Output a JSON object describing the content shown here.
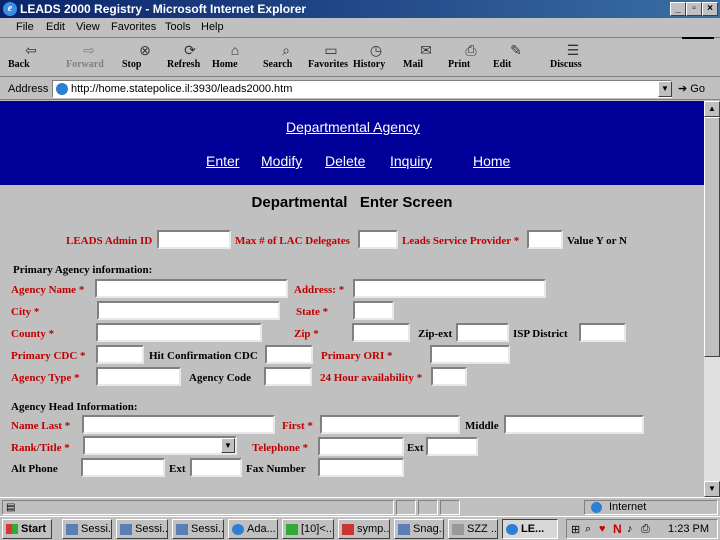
{
  "window": {
    "title": "LEADS 2000 Registry - Microsoft Internet Explorer"
  },
  "menubar": {
    "items": [
      "File",
      "Edit",
      "View",
      "Favorites",
      "Tools",
      "Help"
    ]
  },
  "toolbar": {
    "buttons": [
      "Back",
      "Forward",
      "Stop",
      "Refresh",
      "Home",
      "Search",
      "Favorites",
      "History",
      "Mail",
      "Print",
      "Edit",
      "Discuss"
    ]
  },
  "address": {
    "label": "Address",
    "url": "http://home.statepolice.il:3930/leads2000.htm",
    "go": "Go"
  },
  "banner": {
    "title": "Departmental Agency",
    "nav": [
      "Enter",
      "Modify",
      "Delete",
      "Inquiry",
      "Home"
    ]
  },
  "form": {
    "title": "Departmental   Enter Screen",
    "row1": {
      "admin_id": "LEADS Admin ID",
      "max_lac": "Max # of LAC Delegates",
      "service_provider": "Leads Service Provider *",
      "value_hint": "Value Y or N"
    },
    "primary_heading": "Primary Agency information:",
    "agency_name": "Agency Name *",
    "address": "Address: *",
    "city": "City  *",
    "state": "State *",
    "county": "County *",
    "zip": "Zip *",
    "zip_ext": "Zip-ext",
    "isp_district": "ISP District",
    "primary_cdc": "Primary CDC *",
    "hit_cdc": "Hit Confirmation CDC",
    "primary_ori": "Primary ORI *",
    "agency_type": "Agency Type *",
    "agency_code": "Agency Code",
    "availability": "24 Hour availability *",
    "head_heading": "Agency Head Information:",
    "name_last": "Name Last *",
    "first": "First *",
    "middle": "Middle",
    "rank_title": "Rank/Title *",
    "telephone": "Telephone *",
    "ext": "Ext",
    "alt_phone": "Alt Phone",
    "ext2": "Ext",
    "fax": "Fax Number"
  },
  "status": {
    "zone": "Internet"
  },
  "taskbar": {
    "start": "Start",
    "tasks": [
      "Sessi...",
      "Sessi...",
      "Sessi...",
      "Ada...",
      "[10]<...",
      "symp...",
      "Snag...",
      "SZZ ...",
      "LE..."
    ],
    "clock": "1:23 PM"
  }
}
